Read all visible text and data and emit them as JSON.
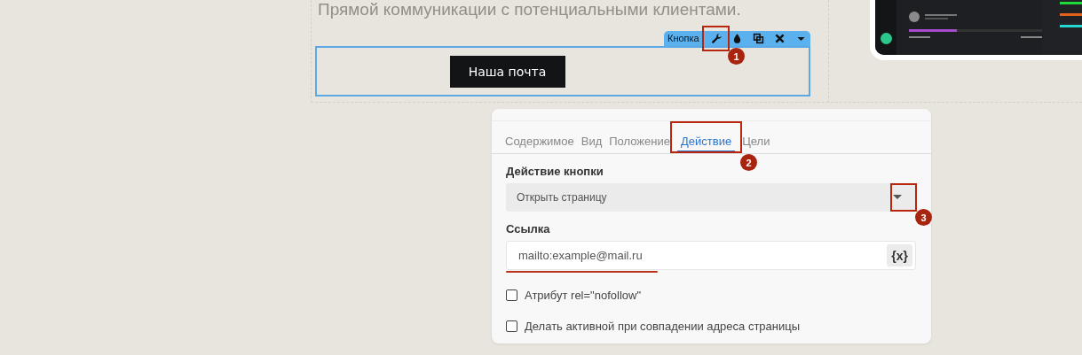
{
  "intro_text": "Прямой коммуникации с потенциальными клиентами.",
  "block_toolbar": {
    "label": "Кнопка"
  },
  "button": {
    "label": "Наша почта"
  },
  "tabs": [
    {
      "label": "Содержимое",
      "selected": false
    },
    {
      "label": "Вид",
      "selected": false
    },
    {
      "label": "Положение",
      "selected": false
    },
    {
      "label": "Действие",
      "selected": true
    },
    {
      "label": "Цели",
      "selected": false
    }
  ],
  "action": {
    "label": "Действие кнопки",
    "value": "Открыть страницу"
  },
  "link": {
    "label": "Ссылка",
    "value": "mailto:example@mail.ru",
    "variable_button": "{x}"
  },
  "checkboxes": [
    {
      "label": "Атрибут rel=\"nofollow\"",
      "checked": false
    },
    {
      "label": "Делать активной при совпадении адреса страницы",
      "checked": false
    }
  ],
  "annotations": [
    {
      "number": "1"
    },
    {
      "number": "2"
    },
    {
      "number": "3"
    }
  ]
}
